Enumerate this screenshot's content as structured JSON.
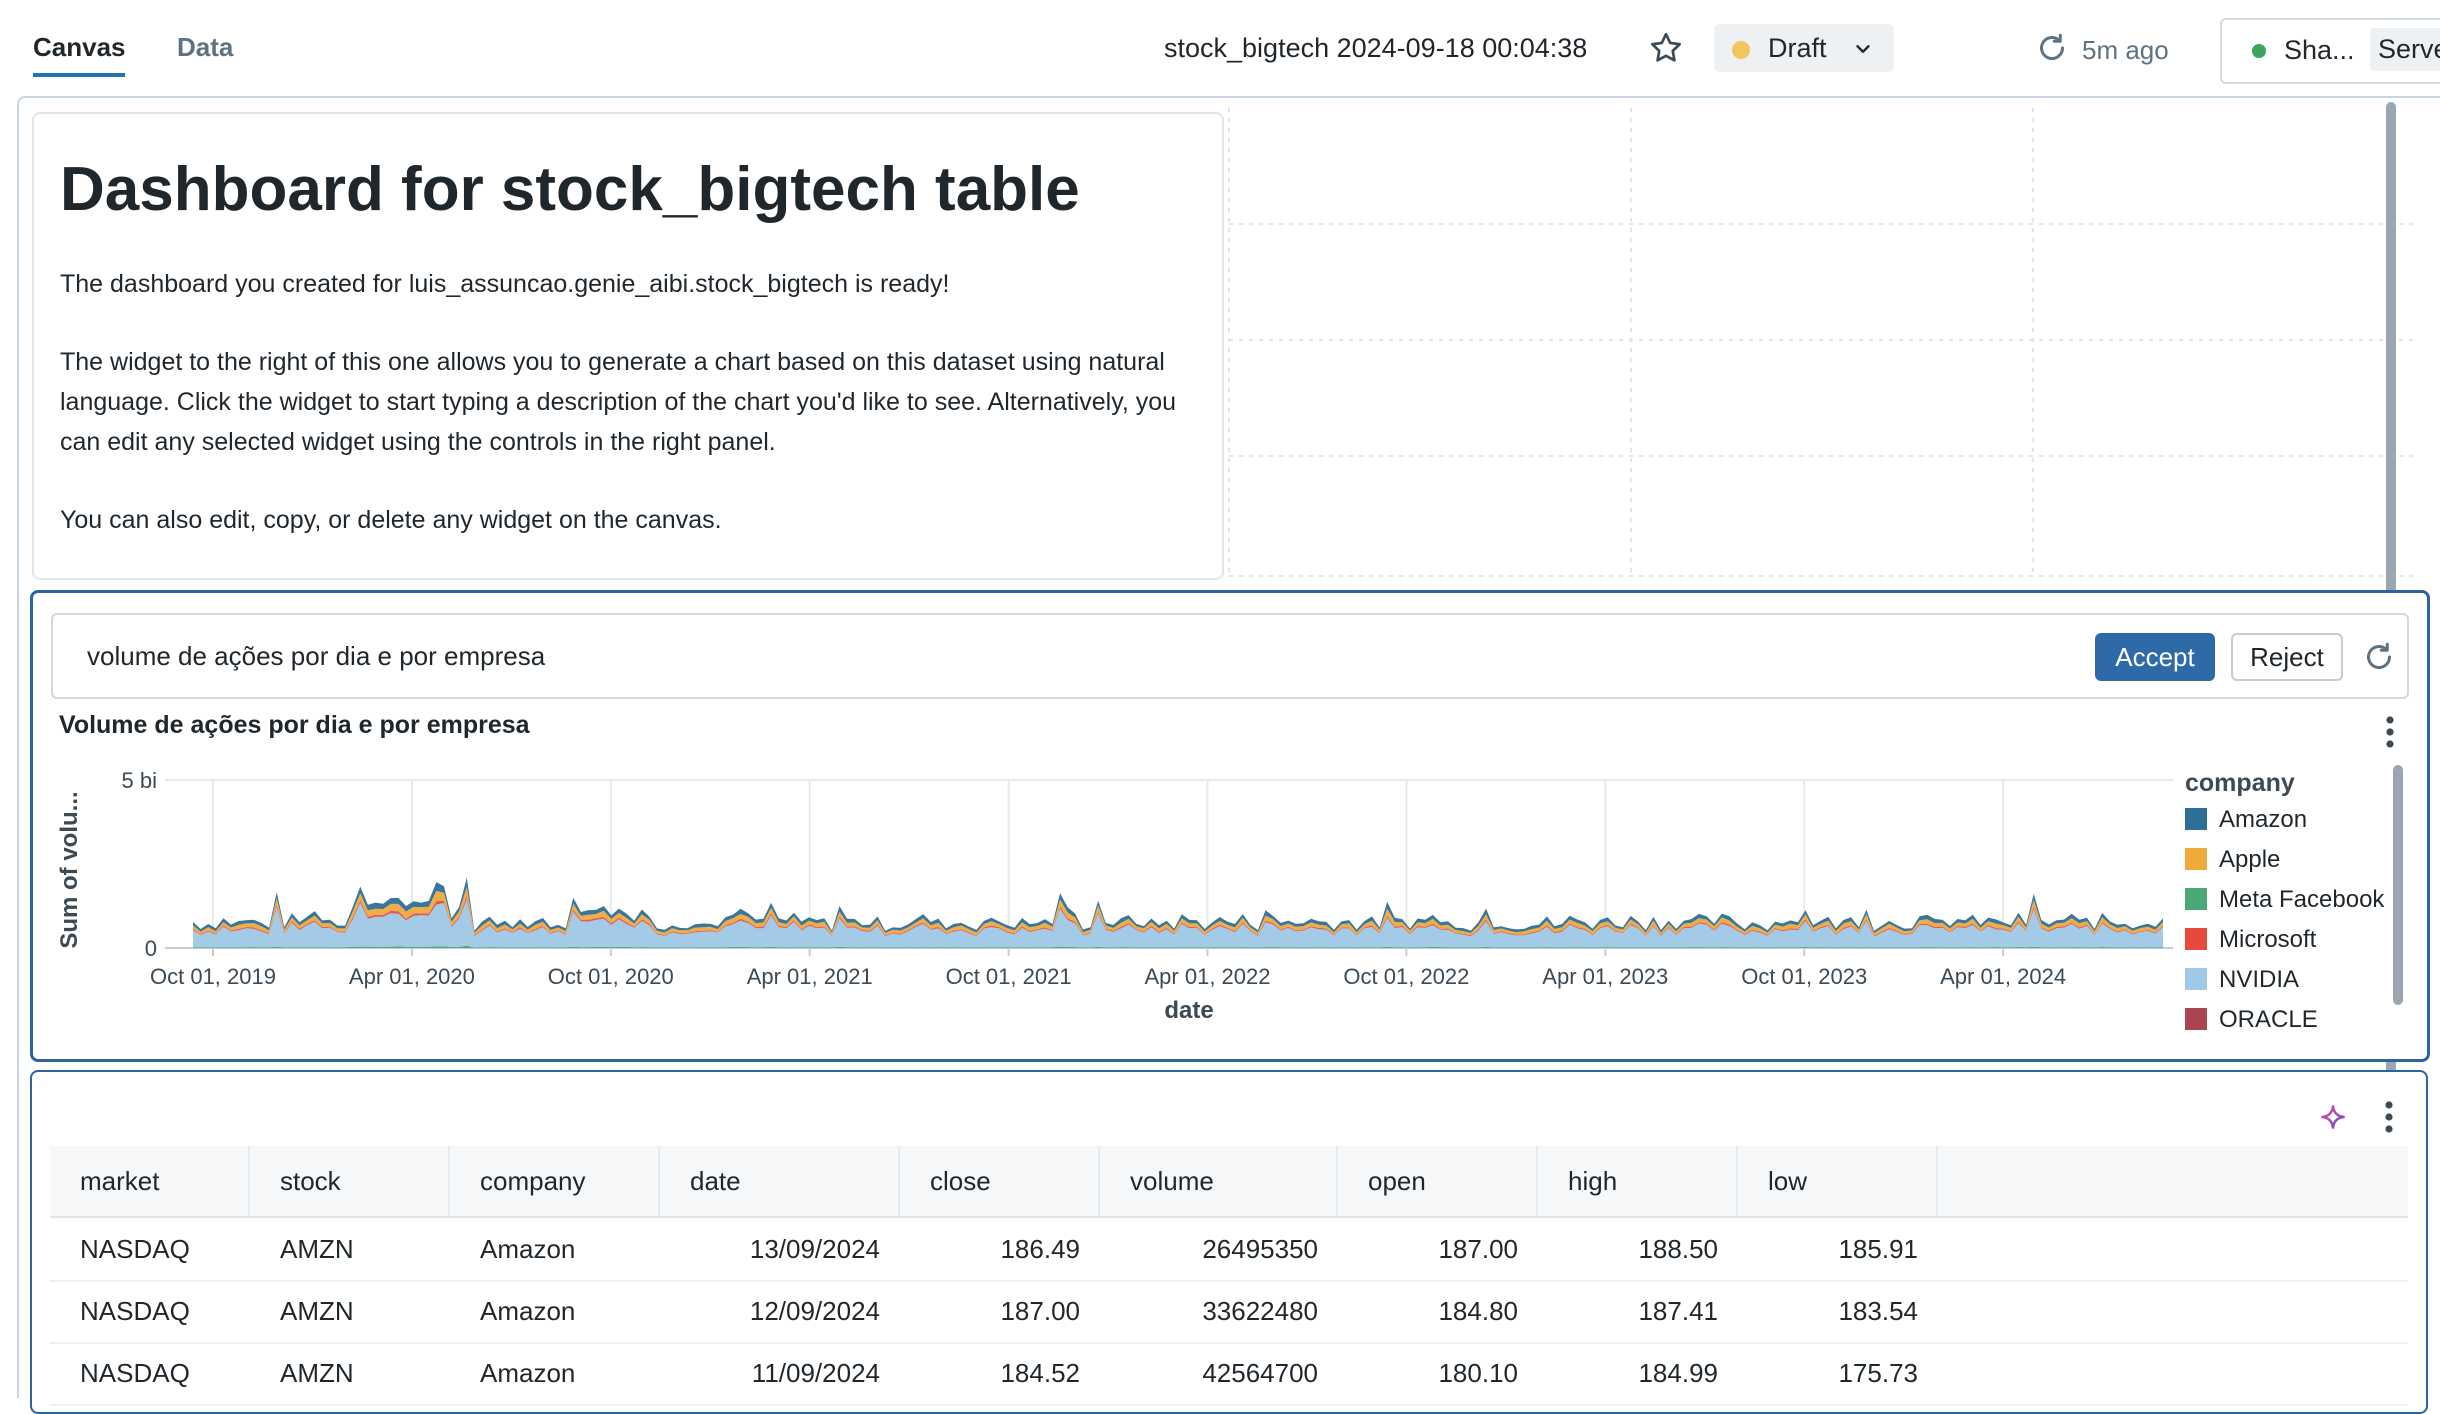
{
  "tabs": {
    "canvas": "Canvas",
    "data": "Data"
  },
  "header": {
    "title": "stock_bigtech 2024-09-18 00:04:38",
    "status": "Draft",
    "refreshed": "5m ago",
    "share": "Sha...",
    "serve": "Serve"
  },
  "text_widget": {
    "title": "Dashboard for stock_bigtech table",
    "p1": "The dashboard you created for luis_assuncao.genie_aibi.stock_bigtech is ready!",
    "p2": "The widget to the right of this one allows you to generate a chart based on this dataset using natural language. Click the widget to start typing a description of the chart you'd like to see. Alternatively, you can edit any selected widget using the controls in the right panel.",
    "p3": "You can also edit, copy, or delete any widget on the canvas."
  },
  "ai_widget": {
    "prompt": "volume de ações por dia e por empresa",
    "accept": "Accept",
    "reject": "Reject"
  },
  "chart_data": {
    "type": "area",
    "title": "Volume de ações por dia e por empresa",
    "xlabel": "date",
    "ylabel": "Sum of volu...",
    "y_ticks": [
      "0",
      "5 bi"
    ],
    "ylim": [
      0,
      5000000000
    ],
    "x_ticks": [
      "Oct 01, 2019",
      "Apr 01, 2020",
      "Oct 01, 2020",
      "Apr 01, 2021",
      "Oct 01, 2021",
      "Apr 01, 2022",
      "Oct 01, 2022",
      "Apr 01, 2023",
      "Oct 01, 2023",
      "Apr 01, 2024"
    ],
    "stacked": true,
    "grid": true,
    "legend_title": "company",
    "legend_position": "right",
    "series": [
      {
        "name": "Amazon",
        "color": "#2e6f96",
        "approx_daily_volume": 90000000
      },
      {
        "name": "Apple",
        "color": "#f0a93b",
        "approx_daily_volume": 100000000
      },
      {
        "name": "Meta Facebook",
        "color": "#4aa876",
        "approx_daily_volume": 20000000
      },
      {
        "name": "Microsoft",
        "color": "#e8493d",
        "approx_daily_volume": 25000000
      },
      {
        "name": "NVIDIA",
        "color": "#9ec8e6",
        "approx_daily_volume": 500000000
      },
      {
        "name": "ORACLE",
        "color": "#a8454e",
        "approx_daily_volume": 8000000
      }
    ]
  },
  "table": {
    "columns": [
      "market",
      "stock",
      "company",
      "date",
      "close",
      "volume",
      "open",
      "high",
      "low"
    ],
    "rows": [
      [
        "NASDAQ",
        "AMZN",
        "Amazon",
        "13/09/2024",
        "186.49",
        "26495350",
        "187.00",
        "188.50",
        "185.91"
      ],
      [
        "NASDAQ",
        "AMZN",
        "Amazon",
        "12/09/2024",
        "187.00",
        "33622480",
        "184.80",
        "187.41",
        "183.54"
      ],
      [
        "NASDAQ",
        "AMZN",
        "Amazon",
        "11/09/2024",
        "184.52",
        "42564700",
        "180.10",
        "184.99",
        "175.73"
      ]
    ]
  }
}
